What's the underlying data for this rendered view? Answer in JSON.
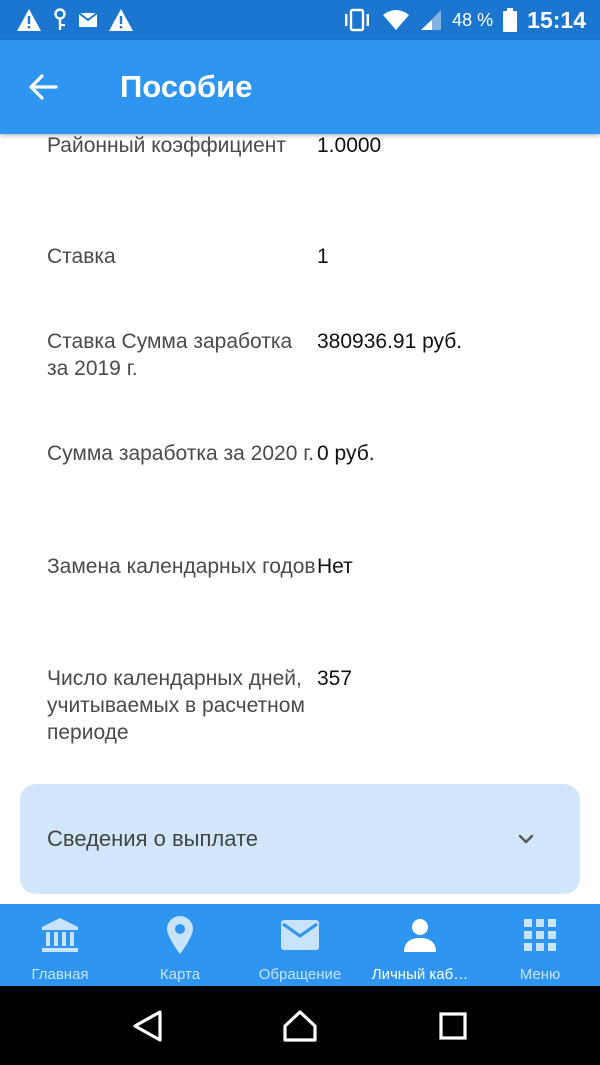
{
  "status_bar": {
    "battery_percent": "48 %",
    "time": "15:14",
    "left_icons": [
      "warning-icon",
      "key-icon",
      "mail-icon",
      "warning-icon"
    ],
    "right_icons": [
      "vibrate-icon",
      "wifi-icon",
      "signal-icon",
      "battery-icon"
    ]
  },
  "app_bar": {
    "title": "Пособие",
    "back_icon": "arrow-left-icon"
  },
  "details": [
    {
      "label": "Районный коэффициент",
      "value": "1.0000"
    },
    {
      "label": "Ставка",
      "value": "1"
    },
    {
      "label": "Ставка Сумма заработка за 2019 г.",
      "value": "380936.91 руб."
    },
    {
      "label": "Сумма заработка за 2020 г.",
      "value": "0 руб."
    },
    {
      "label": "Замена календарных годов",
      "value": "Нет"
    },
    {
      "label": "Число календарных дней, учитываемых в расчетном периоде",
      "value": "357"
    }
  ],
  "accordion": {
    "label": "Сведения о выплате",
    "icon": "chevron-down-icon"
  },
  "bottom_nav": {
    "items": [
      {
        "label": "Главная",
        "icon": "bank-icon",
        "active": false
      },
      {
        "label": "Карта",
        "icon": "map-pin-icon",
        "active": false
      },
      {
        "label": "Обращение",
        "icon": "mail-icon",
        "active": false
      },
      {
        "label": "Личный каб…",
        "icon": "person-icon",
        "active": true
      },
      {
        "label": "Меню",
        "icon": "grid-icon",
        "active": false
      }
    ]
  },
  "colors": {
    "status_bar": "#1a76cf",
    "primary": "#2e96f0",
    "accordion_bg": "#d2e6fa"
  }
}
